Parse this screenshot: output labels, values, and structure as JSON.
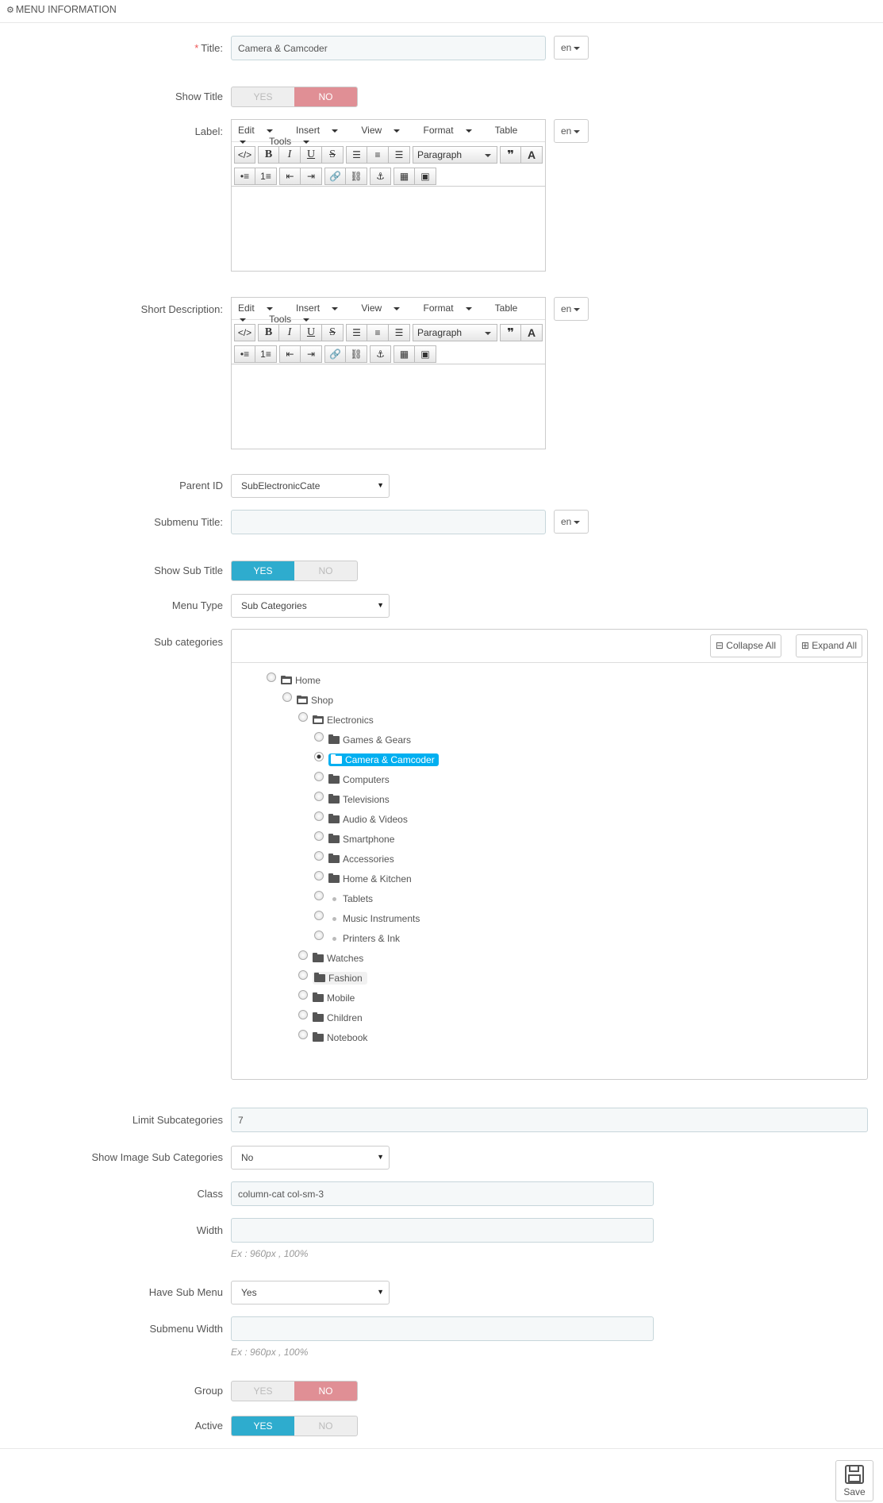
{
  "header": {
    "title": "MENU INFORMATION"
  },
  "title_field": {
    "label": "Title:",
    "value": "Camera & Camcoder",
    "lang": "en"
  },
  "show_title": {
    "label": "Show Title",
    "yes": "YES",
    "no": "NO",
    "selected": "NO"
  },
  "label_field": {
    "label": "Label:",
    "lang": "en"
  },
  "short_desc": {
    "label": "Short Description:",
    "lang": "en"
  },
  "editor": {
    "menus": [
      "Edit",
      "Insert",
      "View",
      "Format",
      "Table",
      "Tools"
    ],
    "block_format": "Paragraph"
  },
  "parent_id": {
    "label": "Parent ID",
    "value": "SubElectronicCate"
  },
  "submenu_title": {
    "label": "Submenu Title:",
    "value": "",
    "lang": "en"
  },
  "show_sub_title": {
    "label": "Show Sub Title",
    "yes": "YES",
    "no": "NO",
    "selected": "YES"
  },
  "menu_type": {
    "label": "Menu Type",
    "value": "Sub Categories"
  },
  "sub_categories": {
    "label": "Sub categories",
    "collapse_all": "Collapse All",
    "expand_all": "Expand All",
    "tree": [
      {
        "label": "Home",
        "depth": 0,
        "kind": "open"
      },
      {
        "label": "Shop",
        "depth": 1,
        "kind": "open"
      },
      {
        "label": "Electronics",
        "depth": 2,
        "kind": "open"
      },
      {
        "label": "Games & Gears",
        "depth": 3,
        "kind": "closed"
      },
      {
        "label": "Camera & Camcoder",
        "depth": 3,
        "kind": "closed",
        "selected": true
      },
      {
        "label": "Computers",
        "depth": 3,
        "kind": "closed"
      },
      {
        "label": "Televisions",
        "depth": 3,
        "kind": "closed"
      },
      {
        "label": "Audio & Videos",
        "depth": 3,
        "kind": "closed"
      },
      {
        "label": "Smartphone",
        "depth": 3,
        "kind": "closed"
      },
      {
        "label": "Accessories",
        "depth": 3,
        "kind": "closed"
      },
      {
        "label": "Home & Kitchen",
        "depth": 3,
        "kind": "closed"
      },
      {
        "label": "Tablets",
        "depth": 3,
        "kind": "leaf"
      },
      {
        "label": "Music Instruments",
        "depth": 3,
        "kind": "leaf"
      },
      {
        "label": "Printers & Ink",
        "depth": 3,
        "kind": "leaf"
      },
      {
        "label": "Watches",
        "depth": 2,
        "kind": "closed"
      },
      {
        "label": "Fashion",
        "depth": 2,
        "kind": "closed",
        "hover": true
      },
      {
        "label": "Mobile",
        "depth": 2,
        "kind": "closed"
      },
      {
        "label": "Children",
        "depth": 2,
        "kind": "closed"
      },
      {
        "label": "Notebook",
        "depth": 2,
        "kind": "closed"
      }
    ]
  },
  "limit_subcategories": {
    "label": "Limit Subcategories",
    "value": "7"
  },
  "show_image_sub": {
    "label": "Show Image Sub Categories",
    "value": "No"
  },
  "class_field": {
    "label": "Class",
    "value": "column-cat col-sm-3"
  },
  "width_field": {
    "label": "Width",
    "value": "",
    "help": "Ex : 960px , 100%"
  },
  "have_sub_menu": {
    "label": "Have Sub Menu",
    "value": "Yes"
  },
  "submenu_width": {
    "label": "Submenu Width",
    "value": "",
    "help": "Ex : 960px , 100%"
  },
  "group": {
    "label": "Group",
    "yes": "YES",
    "no": "NO",
    "selected": "NO"
  },
  "active": {
    "label": "Active",
    "yes": "YES",
    "no": "NO",
    "selected": "YES"
  },
  "footer": {
    "save_label": "Save"
  }
}
